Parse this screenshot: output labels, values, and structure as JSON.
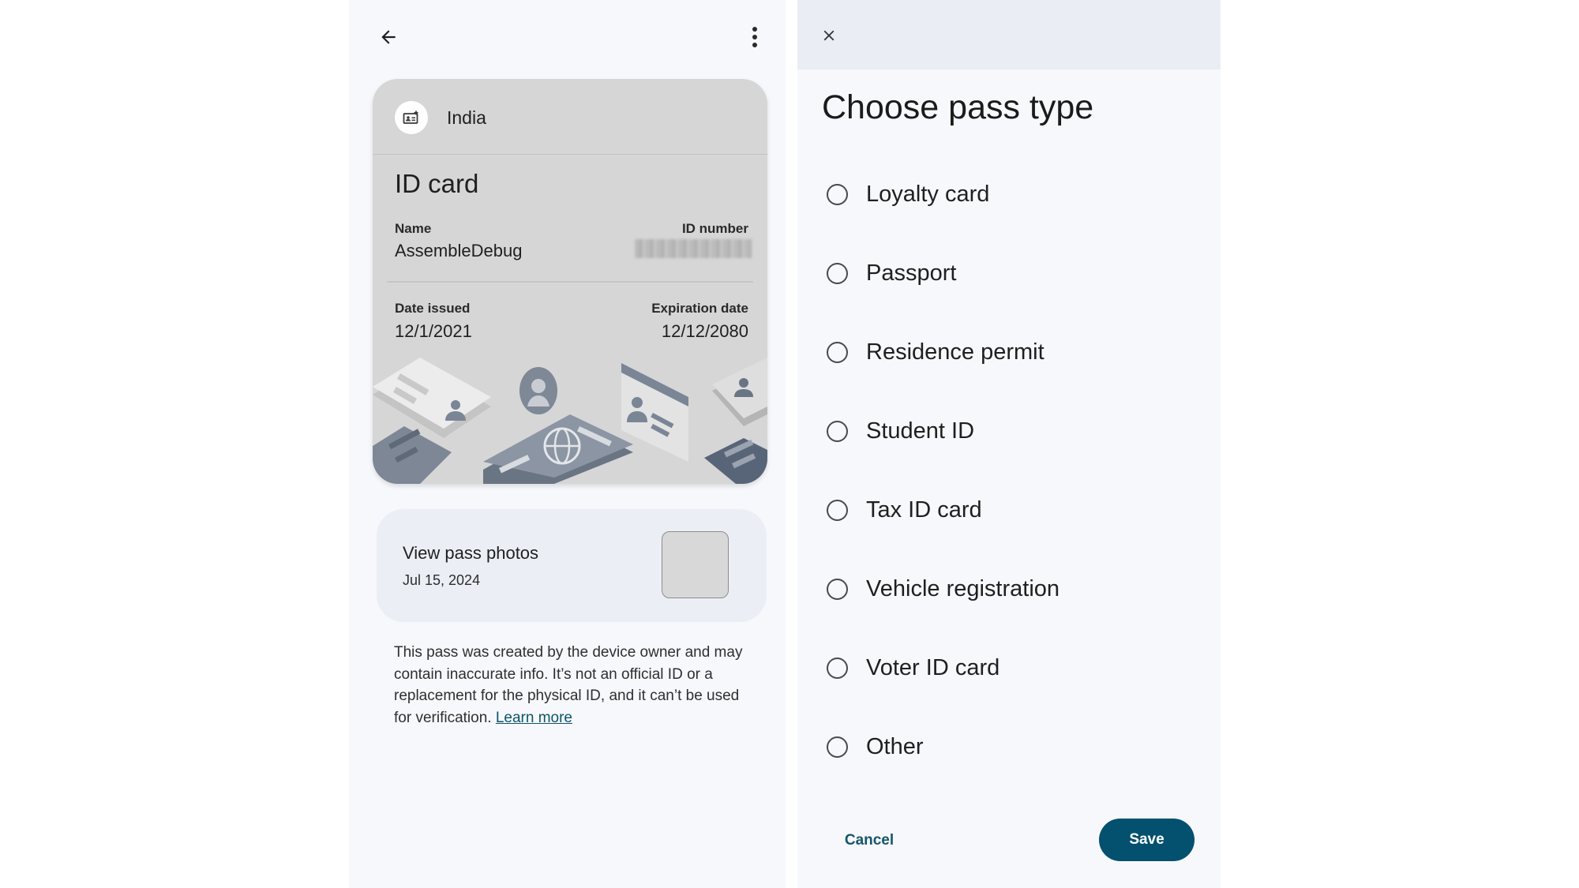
{
  "left_panel": {
    "toolbar": {
      "back_icon": "arrow-back-icon",
      "more_icon": "more-vert-icon"
    },
    "pass_card": {
      "issuer_icon": "id-card-sparkle-icon",
      "issuer": "India",
      "title": "ID card",
      "fields": {
        "name_label": "Name",
        "name_value": "AssembleDebug",
        "id_number_label": "ID number",
        "id_number_value_redacted": true,
        "date_issued_label": "Date issued",
        "date_issued_value": "12/1/2021",
        "expiration_label": "Expiration date",
        "expiration_value": "12/12/2080"
      },
      "background_color": "#d6d6d6"
    },
    "photos": {
      "title": "View pass photos",
      "date": "Jul 15, 2024"
    },
    "disclaimer": {
      "text": "This pass was created by the device owner and may contain inaccurate info. It’s not an official ID or a replacement for the physical ID, and it can’t be used for verification. ",
      "link_label": "Learn more"
    }
  },
  "right_panel": {
    "close_icon": "close-icon",
    "title": "Choose pass type",
    "options": [
      {
        "label": "Loyalty card",
        "selected": false
      },
      {
        "label": "Passport",
        "selected": false
      },
      {
        "label": "Residence permit",
        "selected": false
      },
      {
        "label": "Student ID",
        "selected": false
      },
      {
        "label": "Tax ID card",
        "selected": false
      },
      {
        "label": "Vehicle registration",
        "selected": false
      },
      {
        "label": "Voter ID card",
        "selected": false
      },
      {
        "label": "Other",
        "selected": false
      }
    ],
    "actions": {
      "cancel_label": "Cancel",
      "save_label": "Save"
    },
    "colors": {
      "primary": "#03506f",
      "text_button": "#15566a"
    }
  }
}
